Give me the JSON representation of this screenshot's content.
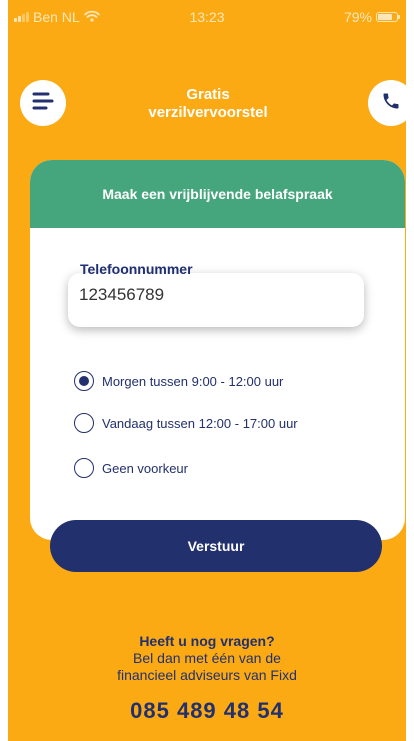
{
  "status_bar": {
    "carrier": "Ben NL",
    "time": "13:23",
    "battery": "79%",
    "battery_level": 0.79
  },
  "header": {
    "title_line1": "Gratis",
    "title_line2": "verzilvervoorstel",
    "menu_icon": "menu-icon",
    "phone_icon": "phone-icon"
  },
  "card": {
    "title": "Maak een vrijblijvende belafspraak",
    "phone_label": "Telefoonnummer",
    "phone_value": "123456789",
    "options": [
      {
        "label": "Morgen tussen 9:00 - 12:00 uur",
        "selected": true
      },
      {
        "label": "Vandaag tussen 12:00 - 17:00 uur",
        "selected": false
      },
      {
        "label": "Geen voorkeur",
        "selected": false
      }
    ],
    "submit_label": "Verstuur"
  },
  "footer": {
    "question": "Heeft u nog vragen?",
    "line1": "Bel dan met één van de",
    "line2": "financieel adviseurs van Fixd",
    "phone": "085 489 48 54"
  },
  "colors": {
    "background": "#fcaa14",
    "card_header": "#45a67d",
    "primary": "#22306e",
    "white": "#ffffff"
  }
}
